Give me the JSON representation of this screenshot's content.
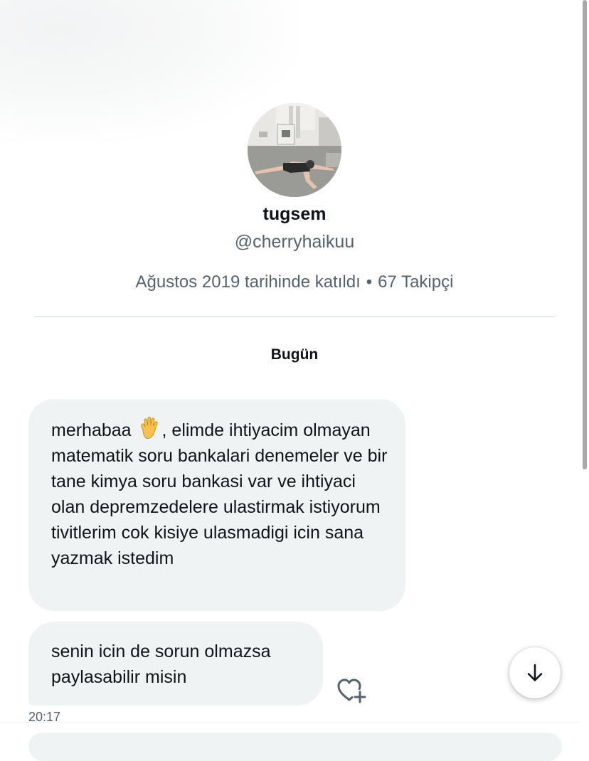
{
  "profile": {
    "display_name": "tugsem",
    "handle": "@cherryhaikuu",
    "joined": "Ağustos 2019 tarihinde katıldı",
    "separator": "•",
    "followers": "67 Takipçi"
  },
  "conversation": {
    "day_label": "Bugün",
    "messages": [
      {
        "text_before_emoji": "merhabaa ",
        "emoji": "raised-hand-emoji",
        "text_after_emoji": ", elimde ihtiyacim olmayan matematik soru bankalari denemeler ve bir tane kimya soru bankasi var ve ihtiyaci olan depremzedelere ulastirmak istiyorum tivitlerim cok kisiye ulasmadigi icin sana yazmak istedim"
      },
      {
        "text": "senin icin de sorun olmazsa paylasabilir misin",
        "time": "20:17"
      }
    ]
  },
  "icons": {
    "react": "heart-plus-icon",
    "scroll_down": "arrow-down-icon"
  },
  "colors": {
    "bubble_bg": "#eff3f4",
    "secondary_text": "#536471",
    "primary_text": "#0f1419"
  }
}
